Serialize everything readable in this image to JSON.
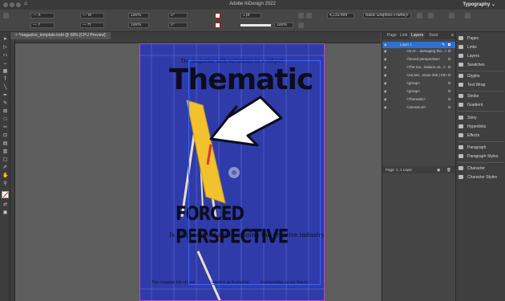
{
  "app": {
    "title": "Adobe InDesign 2022",
    "workspace": "Typography ⌄"
  },
  "control": {
    "fields": [
      "— X",
      "— Y",
      "— W",
      "— H",
      "100%",
      "100%",
      "0°",
      "0°",
      "1 pt",
      "4,233 mm",
      "Basic Graphics Frame]+"
    ],
    "stroke_weight": "1 pt",
    "scale": "100%",
    "offset": "4,233 mm",
    "style": "Basic Graphics Frame]+"
  },
  "document_tab": "*magazine_template.indd @ 58% [CPU Preview]",
  "page": {
    "tagline": "The magazine with variations on a subject",
    "masthead": "Thematic",
    "headline": "FORCED PERSPECTIVE",
    "subline": "Is AI-generated art damaging the creative industry?",
    "footer_left": "The complex life of love",
    "footer_center": "Genetics as Evolution",
    "footer_right": "Outstanding on my theory"
  },
  "panel": {
    "tabs": [
      "Page",
      "Link",
      "Layers",
      "Swat"
    ],
    "active_tab": "Layers",
    "layers": [
      {
        "name": "Layer 1",
        "selected": true
      },
      {
        "name": "<Is AI-...damaging the...>"
      },
      {
        "name": "<forced perspective>"
      },
      {
        "name": "<The ma...riations on...>"
      },
      {
        "name": "<1st Mo...Issue 206 | 03>"
      },
      {
        "name": "<group>"
      },
      {
        "name": "<group>"
      },
      {
        "name": "<Thematic>"
      },
      {
        "name": "<canvas.ai>"
      }
    ],
    "footer": "Page: 1, 1 Layer"
  },
  "dock": {
    "items": [
      "Pages",
      "Links",
      "Layers",
      "Swatches",
      "Glyphs",
      "Text Wrap",
      "Stroke",
      "Gradient",
      "Story",
      "Hyperlinks",
      "Effects",
      "Paragraph",
      "Paragraph Styles",
      "Character",
      "Character Styles"
    ]
  },
  "colors": {
    "page_blue": "#2f3ba8",
    "easel_yellow": "#f2c12e",
    "selection_blue": "#3b66ff",
    "layer_highlight": "#2f6fcf"
  }
}
